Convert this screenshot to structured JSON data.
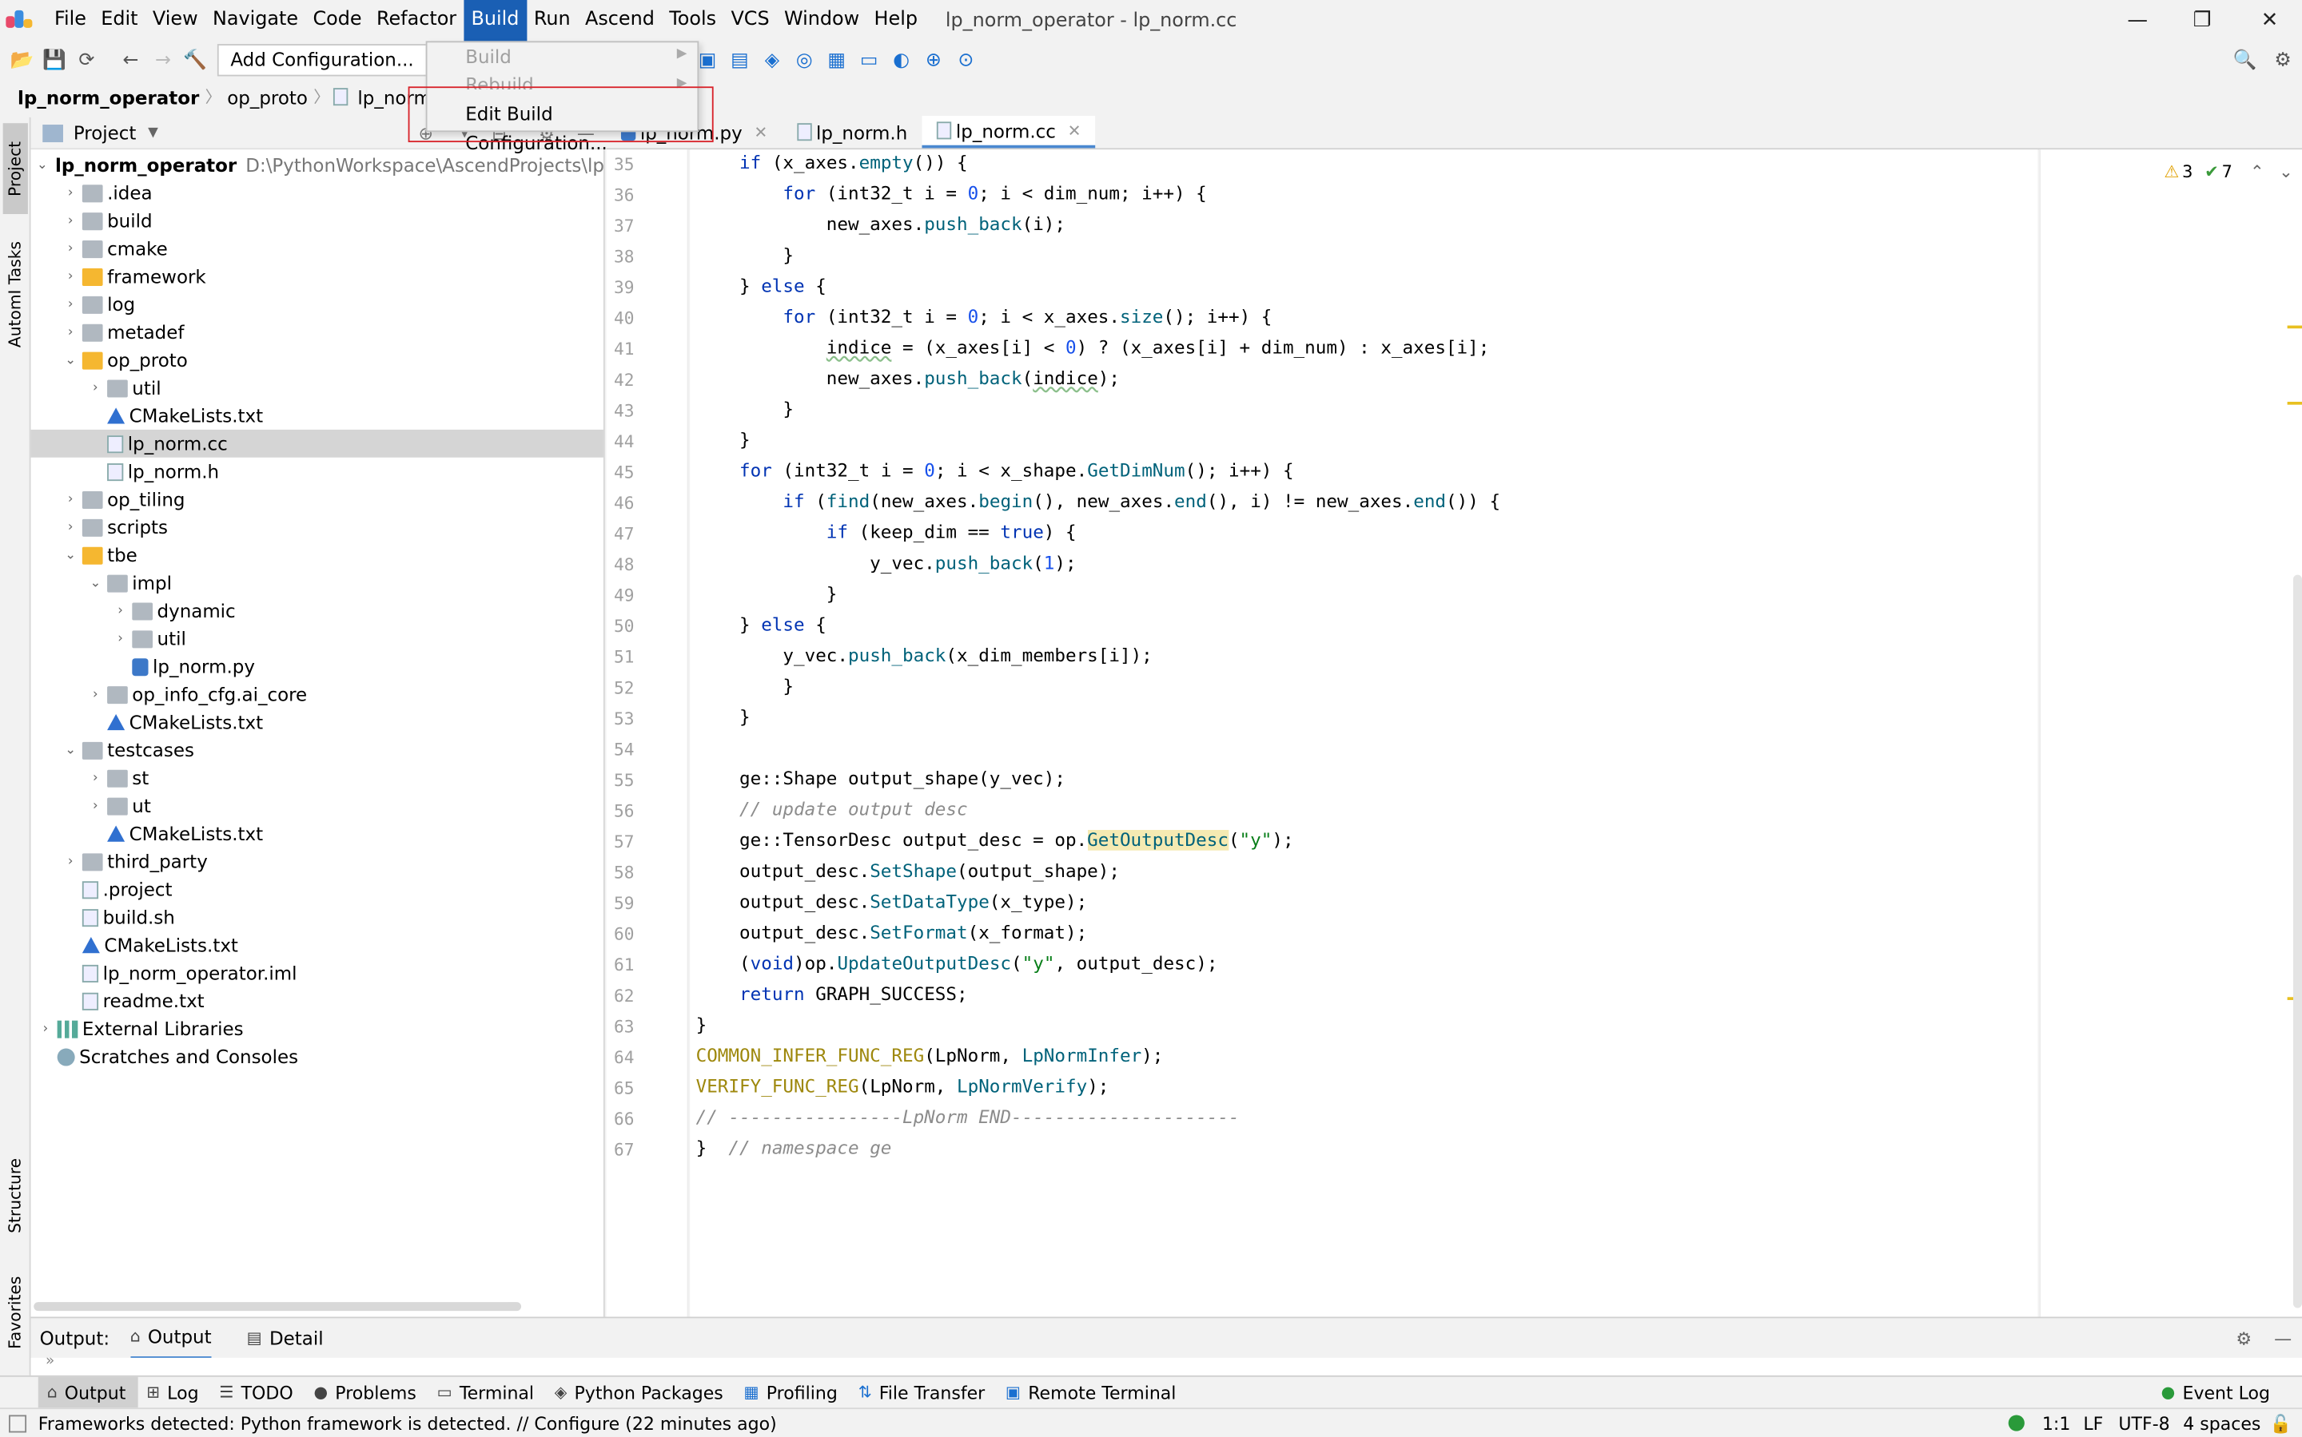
{
  "window": {
    "title": "lp_norm_operator - lp_norm.cc"
  },
  "menu": [
    {
      "id": "file",
      "label": "File"
    },
    {
      "id": "edit",
      "label": "Edit"
    },
    {
      "id": "view",
      "label": "View"
    },
    {
      "id": "navigate",
      "label": "Navigate"
    },
    {
      "id": "code",
      "label": "Code"
    },
    {
      "id": "refactor",
      "label": "Refactor"
    },
    {
      "id": "build",
      "label": "Build"
    },
    {
      "id": "run",
      "label": "Run"
    },
    {
      "id": "ascend",
      "label": "Ascend"
    },
    {
      "id": "tools",
      "label": "Tools"
    },
    {
      "id": "vcs",
      "label": "VCS"
    },
    {
      "id": "window",
      "label": "Window"
    },
    {
      "id": "help",
      "label": "Help"
    }
  ],
  "build_menu": {
    "items": [
      "Build",
      "Rebuild",
      "Edit Build Configuration..."
    ]
  },
  "toolbar": {
    "add_configuration": "Add Configuration..."
  },
  "breadcrumb": [
    "lp_norm_operator",
    "op_proto",
    "lp_norm.cc"
  ],
  "side_tabs": {
    "project": "Project",
    "automl": "AutomI Tasks",
    "structure": "Structure",
    "favorites": "Favorites"
  },
  "project_panel": {
    "title": "Project",
    "root_name": "lp_norm_operator",
    "root_path": "D:\\PythonWorkspace\\AscendProjects\\lp_nor",
    "items": [
      {
        "label": ".idea"
      },
      {
        "label": "build"
      },
      {
        "label": "cmake"
      },
      {
        "label": "framework"
      },
      {
        "label": "log"
      },
      {
        "label": "metadef"
      },
      {
        "label": "op_proto"
      },
      {
        "label": "util"
      },
      {
        "label": "CMakeLists.txt"
      },
      {
        "label": "lp_norm.cc"
      },
      {
        "label": "lp_norm.h"
      },
      {
        "label": "op_tiling"
      },
      {
        "label": "scripts"
      },
      {
        "label": "tbe"
      },
      {
        "label": "impl"
      },
      {
        "label": "dynamic"
      },
      {
        "label": "util"
      },
      {
        "label": "lp_norm.py"
      },
      {
        "label": "op_info_cfg.ai_core"
      },
      {
        "label": "CMakeLists.txt"
      },
      {
        "label": "testcases"
      },
      {
        "label": "st"
      },
      {
        "label": "ut"
      },
      {
        "label": "CMakeLists.txt"
      },
      {
        "label": "third_party"
      },
      {
        "label": ".project"
      },
      {
        "label": "build.sh"
      },
      {
        "label": "CMakeLists.txt"
      },
      {
        "label": "lp_norm_operator.iml"
      },
      {
        "label": "readme.txt"
      },
      {
        "label": "External Libraries"
      },
      {
        "label": "Scratches and Consoles"
      }
    ]
  },
  "editor": {
    "tabs": [
      "lp_norm.py",
      "lp_norm.h",
      "lp_norm.cc"
    ],
    "inspection": {
      "warnings": "3",
      "ok": "7"
    },
    "line_numbers": [
      "35",
      "36",
      "37",
      "38",
      "39",
      "40",
      "41",
      "42",
      "43",
      "44",
      "45",
      "46",
      "47",
      "48",
      "49",
      "50",
      "51",
      "52",
      "53",
      "54",
      "55",
      "56",
      "57",
      "58",
      "59",
      "60",
      "61",
      "62",
      "63",
      "64",
      "65",
      "66",
      "67"
    ]
  },
  "output_panel": {
    "label": "Output:",
    "tabs": [
      "Output",
      "Detail"
    ]
  },
  "bottom_tabs": [
    "Output",
    "Log",
    "TODO",
    "Problems",
    "Terminal",
    "Python Packages",
    "Profiling",
    "File Transfer",
    "Remote Terminal"
  ],
  "event_log": "Event Log",
  "status": {
    "message": "Frameworks detected: Python framework is detected. // Configure (22 minutes ago)",
    "position": "1:1",
    "line_sep": "LF",
    "encoding": "UTF-8",
    "indent": "4 spaces"
  }
}
